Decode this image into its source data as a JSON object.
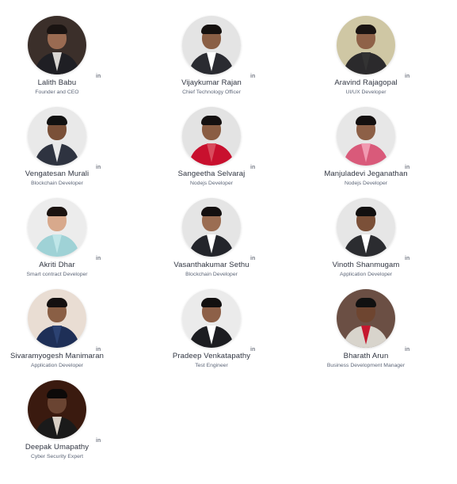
{
  "team": {
    "members": [
      {
        "name": "Lalith Babu",
        "role": "Founder and CEO",
        "social": "in",
        "icon": "linkedin-icon",
        "bg": "#3b2f2a",
        "skin": "#9a6b52",
        "hair": "#1a1412",
        "body": "#1f1f24",
        "shirt": "#d9d6d2"
      },
      {
        "name": "Vijaykumar Rajan",
        "role": "Chief Technology Officer",
        "social": "in",
        "icon": "linkedin-icon",
        "bg": "#e4e4e4",
        "skin": "#8a5f45",
        "hair": "#15110f",
        "body": "#2a2b31",
        "shirt": "#ffffff"
      },
      {
        "name": "Aravind Rajagopal",
        "role": "UI/UX Developer",
        "social": "in",
        "icon": "linkedin-icon",
        "bg": "#cfc7a4",
        "skin": "#8f6248",
        "hair": "#1a1412",
        "body": "#2b2a2c",
        "shirt": "#333333"
      },
      {
        "name": "Vengatesan Murali",
        "role": "Blockchain Developer",
        "social": "in",
        "icon": "linkedin-icon",
        "bg": "#e9e9e9",
        "skin": "#7a5038",
        "hair": "#111111",
        "body": "#2e3340",
        "shirt": "#e8e8e8"
      },
      {
        "name": "Sangeetha Selvaraj",
        "role": "Nodejs Developer",
        "social": "in",
        "icon": "linkedin-icon",
        "bg": "#e3e3e3",
        "skin": "#8a5d43",
        "hair": "#141010",
        "body": "#c8102e",
        "shirt": "#d94b5d"
      },
      {
        "name": "Manjuladevi Jeganathan",
        "role": "Nodejs Developer",
        "social": "in",
        "icon": "linkedin-icon",
        "bg": "#e7e7e7",
        "skin": "#8d6047",
        "hair": "#141010",
        "body": "#d95a7a",
        "shirt": "#f19ab1"
      },
      {
        "name": "Akriti Dhar",
        "role": "Smart contract Developer",
        "social": "in",
        "icon": "linkedin-icon",
        "bg": "#ececec",
        "skin": "#d8a98c",
        "hair": "#1b1310",
        "body": "#9fd2d6",
        "shirt": "#bfe6e8"
      },
      {
        "name": "Vasanthakumar Sethu",
        "role": "Blockchain Developer",
        "social": "in",
        "icon": "linkedin-icon",
        "bg": "#e5e5e5",
        "skin": "#9b6d52",
        "hair": "#141010",
        "body": "#23252b",
        "shirt": "#ffffff"
      },
      {
        "name": "Vinoth Shanmugam",
        "role": "Application Developer",
        "social": "in",
        "icon": "linkedin-icon",
        "bg": "#e6e6e6",
        "skin": "#7b5038",
        "hair": "#121010",
        "body": "#2b2c30",
        "shirt": "#ffffff"
      },
      {
        "name": "Sivaramyogesh Manimaran",
        "role": "Application Developer",
        "social": "in",
        "icon": "linkedin-icon",
        "bg": "#e9ddd3",
        "skin": "#8a5f45",
        "hair": "#141010",
        "body": "#1e2f57",
        "shirt": "#2c4272"
      },
      {
        "name": "Pradeep Venkatapathy",
        "role": "Test Engineer",
        "social": "in",
        "icon": "linkedin-icon",
        "bg": "#ebebeb",
        "skin": "#8d6048",
        "hair": "#121010",
        "body": "#1c1d21",
        "shirt": "#ffffff"
      },
      {
        "name": "Bharath Arun",
        "role": "Business Development Manager",
        "social": "in",
        "icon": "linkedin-icon",
        "bg": "#6b4f44",
        "skin": "#6e4530",
        "hair": "#111111",
        "body": "#d8d4cc",
        "shirt": "#c5182f"
      },
      {
        "name": "Deepak Umapathy",
        "role": "Cyber Security Expert",
        "social": "in",
        "icon": "linkedin-icon",
        "bg": "#3a1a0f",
        "skin": "#6a4432",
        "hair": "#0d0a09",
        "body": "#1a1a1a",
        "shirt": "#d8cfc4"
      }
    ]
  }
}
